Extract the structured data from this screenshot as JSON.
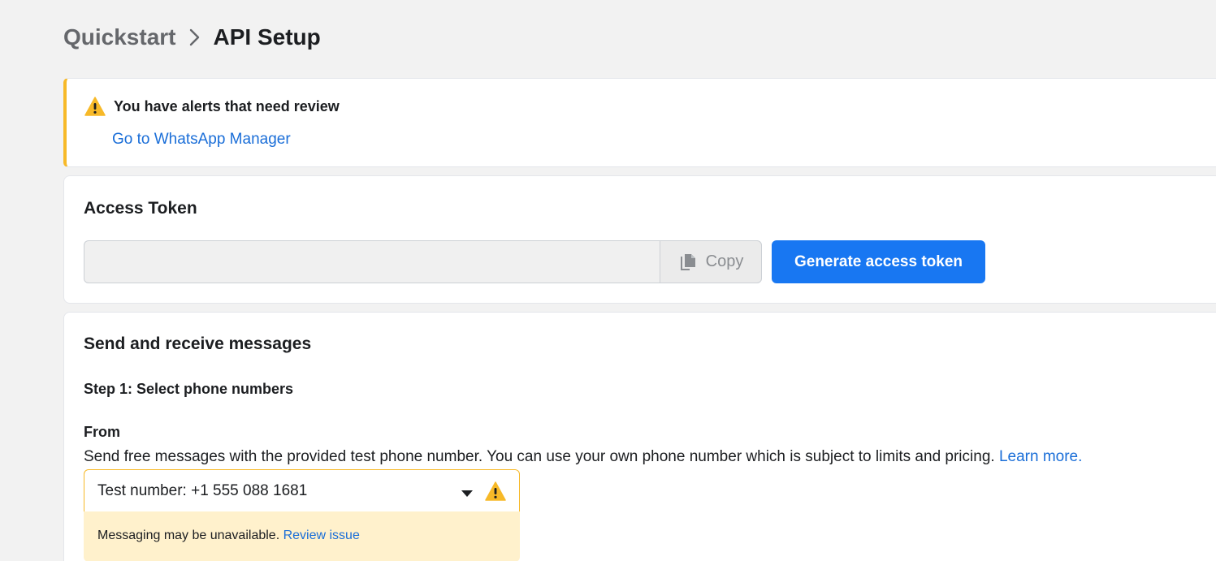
{
  "breadcrumb": {
    "parent": "Quickstart",
    "current": "API Setup"
  },
  "alert": {
    "title": "You have alerts that need review",
    "link": "Go to WhatsApp Manager",
    "icon": "warning-icon",
    "accent": "#f7b928"
  },
  "access_token": {
    "title": "Access Token",
    "value": "",
    "copy_label": "Copy",
    "generate_label": "Generate access token"
  },
  "messages": {
    "title": "Send and receive messages",
    "step1": "Step 1: Select phone numbers",
    "from_label": "From",
    "from_description": "Send free messages with the provided test phone number. You can use your own phone number which is subject to limits and pricing.",
    "learn_more": "Learn more.",
    "selected_number": "Test number: +1 555 088 1681",
    "warning_text": "Messaging may be unavailable.",
    "review_link": "Review issue"
  },
  "colors": {
    "primary": "#1877f2",
    "link": "#1a6ed8",
    "warning": "#f7b928",
    "warning_bg": "#fff1cc"
  }
}
